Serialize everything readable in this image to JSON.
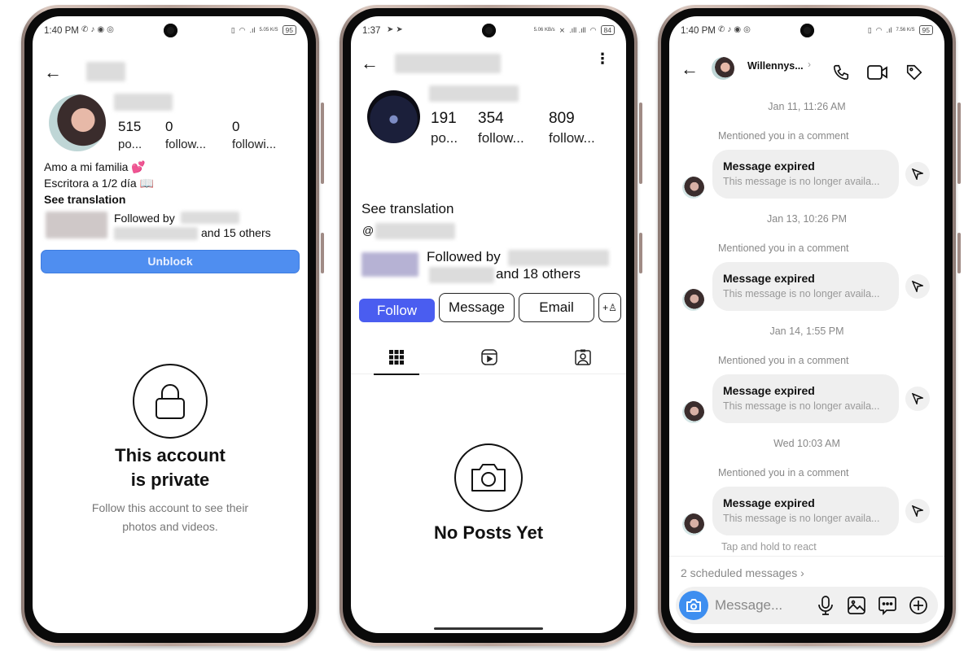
{
  "phones": [
    {
      "status": {
        "time": "1:40 PM",
        "battery": "95",
        "speed": "5.05 K/S"
      },
      "profile": {
        "stats": [
          {
            "value": "515",
            "label": "po..."
          },
          {
            "value": "0",
            "label": "follow..."
          },
          {
            "value": "0",
            "label": "followi..."
          }
        ],
        "bio_lines": [
          "Amo a mi familia 💕",
          "Escritora a 1/2 día 📖"
        ],
        "see_translation": "See translation",
        "followed_by_prefix": "Followed by",
        "followed_by_suffix": "and 15 others",
        "unblock_label": "Unblock",
        "private_title_line1": "This account",
        "private_title_line2": "is private",
        "private_sub_line1": "Follow this account to see their",
        "private_sub_line2": "photos and videos."
      }
    },
    {
      "status": {
        "time": "1:37",
        "battery": "84",
        "speed": "5.06 KB/s"
      },
      "profile": {
        "stats": [
          {
            "value": "191",
            "label": "po..."
          },
          {
            "value": "354",
            "label": "follow..."
          },
          {
            "value": "809",
            "label": "follow..."
          }
        ],
        "see_translation": "See translation",
        "followed_by_prefix": "Followed by",
        "followed_by_suffix": "and 18 others",
        "buttons": {
          "follow": "Follow",
          "message": "Message",
          "email": "Email"
        },
        "tabs": [
          "grid",
          "reels",
          "tagged"
        ],
        "empty_title": "No Posts Yet"
      }
    },
    {
      "status": {
        "time": "1:40 PM",
        "battery": "95",
        "speed": "7.56 K/S"
      },
      "chat": {
        "contact_name": "Willennys...",
        "messages": [
          {
            "timestamp": "Jan 11, 11:26 AM",
            "context": "Mentioned you in a comment",
            "title": "Message expired",
            "body": "This message is no longer availa..."
          },
          {
            "timestamp": "Jan 13, 10:26 PM",
            "context": "Mentioned you in a comment",
            "title": "Message expired",
            "body": "This message is no longer availa..."
          },
          {
            "timestamp": "Jan 14, 1:55 PM",
            "context": "Mentioned you in a comment",
            "title": "Message expired",
            "body": "This message is no longer availa..."
          },
          {
            "timestamp": "Wed 10:03 AM",
            "context": "Mentioned you in a comment",
            "title": "Message expired",
            "body": "This message is no longer availa..."
          }
        ],
        "react_hint": "Tap and hold to react",
        "scheduled": "2 scheduled messages ›",
        "composer_placeholder": "Message...",
        "accent": "#3d8ef0"
      }
    }
  ]
}
